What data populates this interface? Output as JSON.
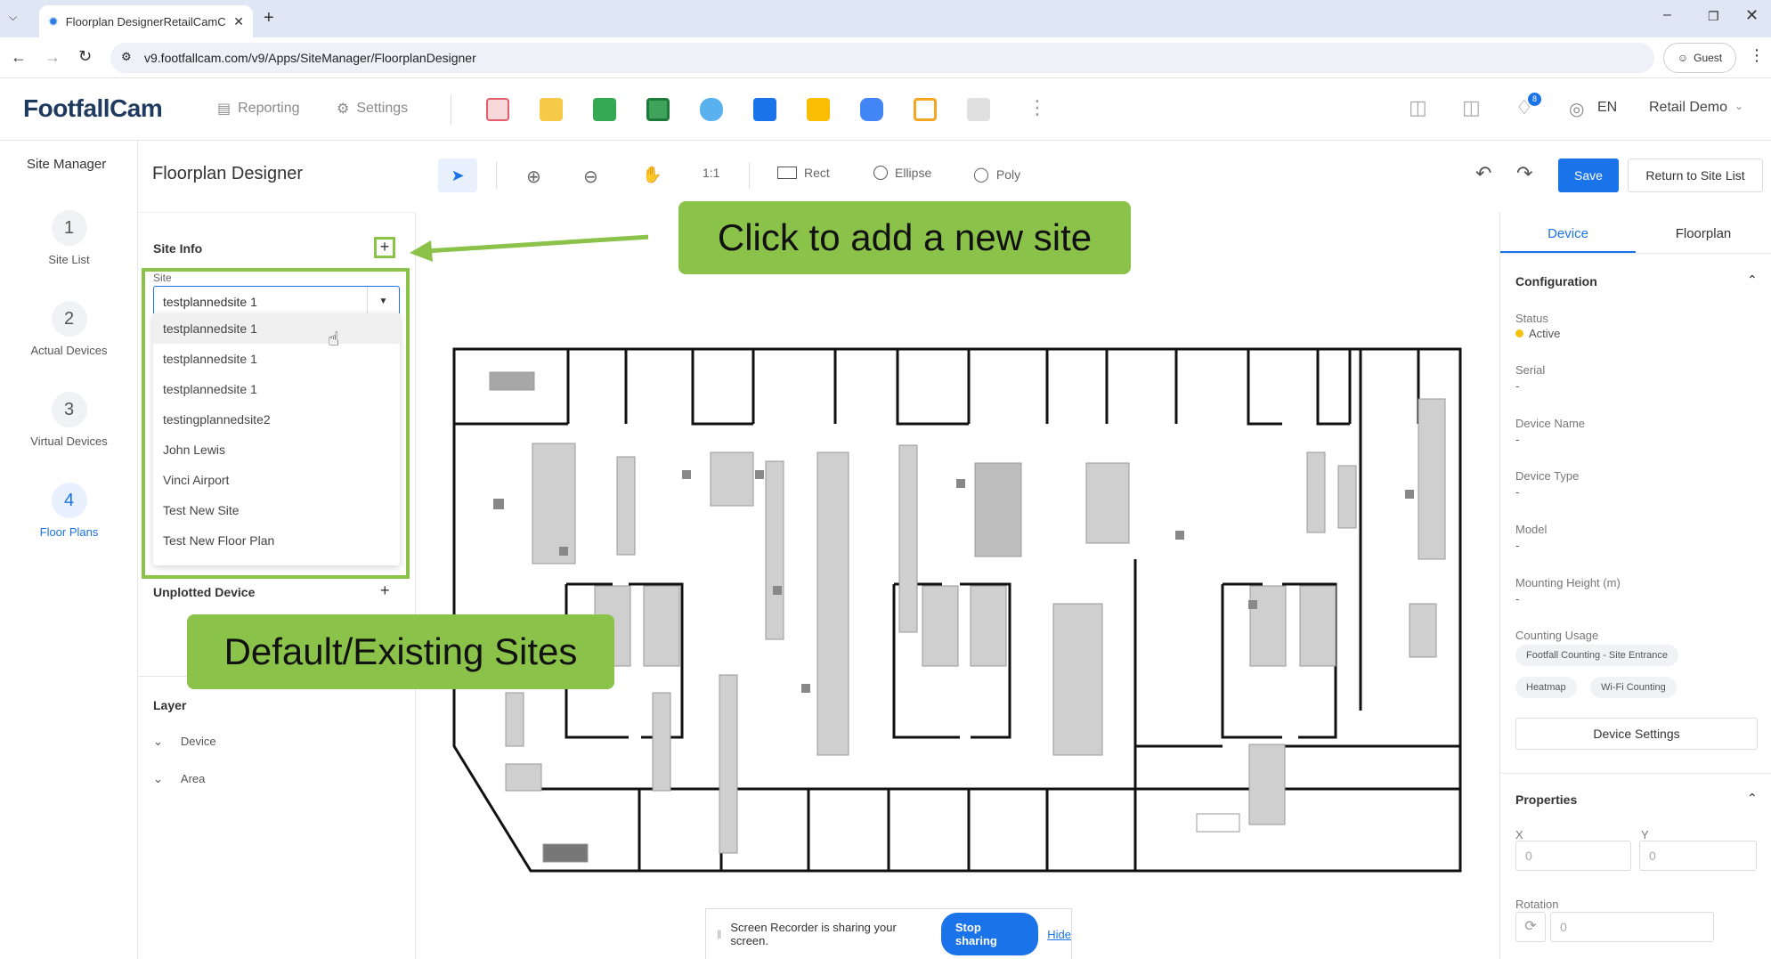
{
  "browser": {
    "tab_title": "Floorplan DesignerRetailCamC...",
    "url": "v9.footfallcam.com/v9/Apps/SiteManager/FloorplanDesigner",
    "profile_label": "Guest"
  },
  "header": {
    "logo": "FootfallCam",
    "nav": {
      "reporting": "Reporting",
      "settings": "Settings"
    },
    "lang": "EN",
    "account": "Retail Demo",
    "notification_count": "8"
  },
  "rail": {
    "title": "Site Manager",
    "steps": [
      {
        "num": "1",
        "label": "Site List"
      },
      {
        "num": "2",
        "label": "Actual Devices"
      },
      {
        "num": "3",
        "label": "Virtual Devices"
      },
      {
        "num": "4",
        "label": "Floor Plans"
      }
    ]
  },
  "toolbar": {
    "title": "Floorplan Designer",
    "zoom_reset": "1:1",
    "rect": "Rect",
    "ellipse": "Ellipse",
    "poly": "Poly",
    "save": "Save",
    "return": "Return to Site List"
  },
  "left_panel": {
    "site_info": "Site Info",
    "site_label": "Site",
    "site_value": "testplannedsite 1",
    "options": [
      "testplannedsite 1",
      "testplannedsite 1",
      "testplannedsite 1",
      "testingplannedsite2",
      "John Lewis",
      "Vinci Airport",
      "Test New Site",
      "Test New Floor Plan"
    ],
    "unplotted": "Unplotted Device",
    "layer": "Layer",
    "layer_items": [
      "Device",
      "Area"
    ]
  },
  "right_panel": {
    "tabs": [
      "Device",
      "Floorplan"
    ],
    "configuration": "Configuration",
    "status_label": "Status",
    "status_value": "Active",
    "fields": [
      {
        "label": "Serial",
        "value": "-"
      },
      {
        "label": "Device Name",
        "value": "-"
      },
      {
        "label": "Device Type",
        "value": "-"
      },
      {
        "label": "Model",
        "value": "-"
      },
      {
        "label": "Mounting Height (m)",
        "value": "-"
      }
    ],
    "counting_usage": "Counting Usage",
    "chips": [
      "Footfall Counting - Site Entrance",
      "Heatmap",
      "Wi-Fi Counting"
    ],
    "device_settings": "Device Settings",
    "properties": "Properties",
    "x_label": "X",
    "y_label": "Y",
    "x_value": "0",
    "y_value": "0",
    "rotation": "Rotation",
    "rotation_value": "0"
  },
  "callouts": {
    "add_site": "Click to add a new site",
    "existing": "Default/Existing Sites"
  },
  "recorder": {
    "message": "Screen Recorder is sharing your screen.",
    "stop": "Stop sharing",
    "hide": "Hide"
  },
  "colors": {
    "primary": "#1a73e8",
    "callout_green": "#8bc34a",
    "status_active": "#f4c20d"
  }
}
